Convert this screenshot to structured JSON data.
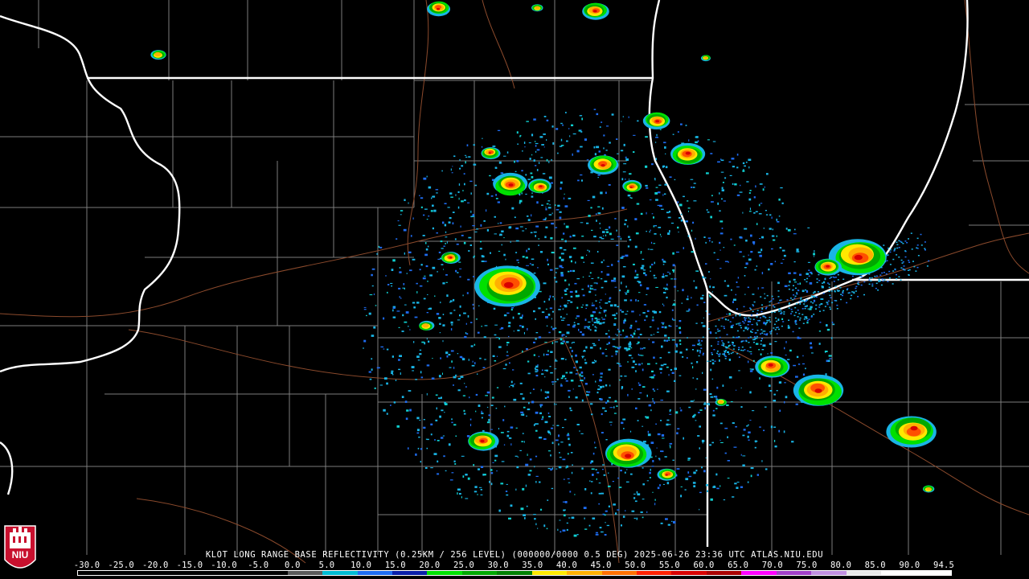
{
  "caption": "KLOT LONG RANGE BASE REFLECTIVITY (0.25KM / 256 LEVEL) (000000/0000 0.5 DEG) 2025-06-26 23:36 UTC  ATLAS.NIU.EDU",
  "logo": {
    "text": "NIU",
    "icon": "niu-tower-seal"
  },
  "colors": {
    "background": "#000000",
    "state_border": "#ffffff",
    "county_border": "#8c8c8c",
    "highway": "#8b4a2c"
  },
  "scale": {
    "ticks": [
      "-30.0",
      "-25.0",
      "-20.0",
      "-15.0",
      "-10.0",
      "-5.0",
      "0.0",
      "5.0",
      "10.0",
      "15.0",
      "20.0",
      "25.0",
      "30.0",
      "35.0",
      "40.0",
      "45.0",
      "50.0",
      "55.0",
      "60.0",
      "65.0",
      "70.0",
      "75.0",
      "80.0",
      "85.0",
      "90.0",
      "94.5"
    ],
    "colors": [
      "#000000",
      "#000000",
      "#000000",
      "#000000",
      "#000000",
      "#000000",
      "#5a5a5a",
      "#00bcd4",
      "#1e6cf0",
      "#0a1fa8",
      "#00e000",
      "#00a800",
      "#008000",
      "#ffe800",
      "#ffb000",
      "#ff7000",
      "#ff2000",
      "#d80000",
      "#a80000",
      "#ff00ff",
      "#a040c8",
      "#c090e0",
      "#e8e8e8",
      "#ffffff",
      "#ffffff"
    ]
  },
  "echoes": [
    {
      "lat": 0,
      "lon": 0,
      "dbz": 45,
      "rx": 45,
      "ry": 28
    },
    {
      "lat": 0,
      "lon": 0,
      "dbz": 40,
      "rx": 30,
      "ry": 16
    }
  ]
}
